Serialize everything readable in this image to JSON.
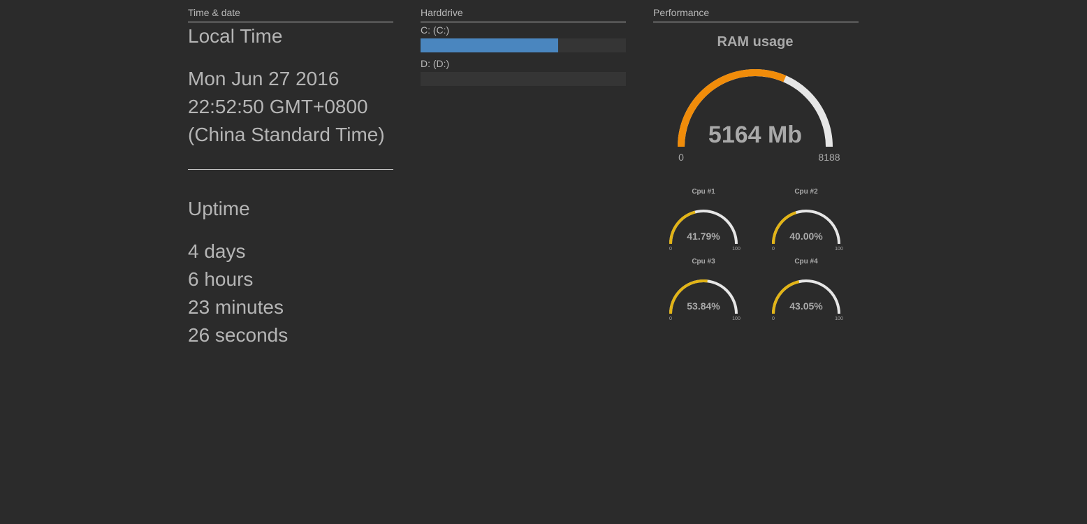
{
  "panels": {
    "time": {
      "header": "Time & date",
      "local_time_heading": "Local Time",
      "datetime_lines": [
        "Mon Jun 27 2016",
        "22:52:50 GMT+0800",
        "(China Standard Time)"
      ],
      "uptime_heading": "Uptime",
      "uptime_lines": [
        "4 days",
        "6 hours",
        "23 minutes",
        "26 seconds"
      ]
    },
    "harddrive": {
      "header": "Harddrive",
      "drives": [
        {
          "label": "C: (C:)",
          "used_fraction": 0.67
        },
        {
          "label": "D: (D:)",
          "used_fraction": 0.0
        }
      ]
    },
    "performance": {
      "header": "Performance",
      "ram": {
        "title": "RAM usage",
        "value_text": "5164 Mb",
        "value": 5164,
        "min": 0,
        "max": 8188,
        "min_label": "0",
        "max_label": "8188"
      },
      "cpus": [
        {
          "title": "Cpu #1",
          "value": 41.79,
          "value_text": "41.79%",
          "min_label": "0",
          "max_label": "100"
        },
        {
          "title": "Cpu #2",
          "value": 40.0,
          "value_text": "40.00%",
          "min_label": "0",
          "max_label": "100"
        },
        {
          "title": "Cpu #3",
          "value": 53.84,
          "value_text": "53.84%",
          "min_label": "0",
          "max_label": "100"
        },
        {
          "title": "Cpu #4",
          "value": 43.05,
          "value_text": "43.05%",
          "min_label": "0",
          "max_label": "100"
        }
      ]
    }
  },
  "colors": {
    "background": "#2b2b2b",
    "ram_fill": "#f08c0a",
    "cpu_fill": "#e2b416",
    "gauge_track": "#e6e6e6",
    "drive_fill": "#4a86bf",
    "drive_track": "#353535"
  }
}
